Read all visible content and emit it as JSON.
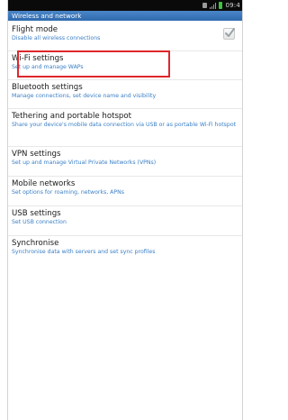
{
  "status_bar": {
    "time": "09:4"
  },
  "header": {
    "title": "Wireless and network"
  },
  "items": [
    {
      "title": "Flight mode",
      "subtitle": "Disable all wireless connections",
      "checked": true
    },
    {
      "title": "Wi-Fi settings",
      "subtitle": "Set up and manage WAPs"
    },
    {
      "title": "Bluetooth settings",
      "subtitle": "Manage connections, set device name and visibility"
    },
    {
      "title": "Tethering and portable hotspot",
      "subtitle": "Share your device's mobile data connection via USB or as portable Wi-Fi hotspot"
    },
    {
      "title": "VPN settings",
      "subtitle": "Set up and manage Virtual Private Networks (VPNs)"
    },
    {
      "title": "Mobile networks",
      "subtitle": "Set options for roaming, networks, APNs"
    },
    {
      "title": "USB settings",
      "subtitle": "Set USB connection"
    },
    {
      "title": "Synchronise",
      "subtitle": "Synchronise data with servers and set sync profiles"
    }
  ],
  "icons": {
    "sim": "sim-icon",
    "signal": "signal-icon",
    "battery": "battery-icon",
    "checkbox": "checkbox-icon"
  },
  "colors": {
    "header": "#2f6aae",
    "subtitle": "#3a7fc5",
    "highlight": "#e0262c",
    "battery": "#3fc43f"
  }
}
